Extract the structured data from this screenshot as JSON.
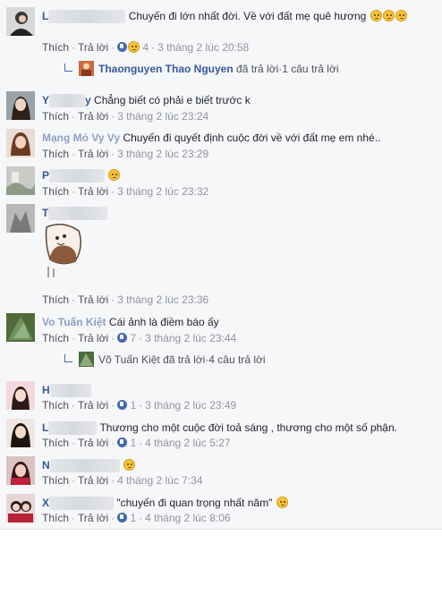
{
  "colors": {
    "link": "#365899",
    "meta": "#90949c",
    "like": "#4267b2",
    "bg": "#f6f7f9"
  },
  "labels": {
    "like": "Thích",
    "reply": "Trả lời",
    "dot": "·"
  },
  "comments": [
    {
      "name_frag": "L",
      "text": "Chuyến đi lớn nhất đời. Về với đất mẹ quê hương",
      "emojis": 3,
      "likes": "4",
      "time": "3 tháng 2 lúc 20:58",
      "reply_summary": {
        "name": "Thaonguyen Thao Nguyen",
        "action": "đã trả lời",
        "count": "1 câu trả lời"
      }
    },
    {
      "name_frag": "Y",
      "name_frag2": "y",
      "text": "Chẳng biết có phải e biết trước k",
      "time": "3 tháng 2 lúc 23:24"
    },
    {
      "name_frag": "Mạng Mỏ Vy Vy",
      "text": "Chuyến đi quyết định cuộc đời về với đất mẹ em nhé..",
      "time": "3 tháng 2 lúc 23:29"
    },
    {
      "name_frag": "P",
      "text": "",
      "emojis": 1,
      "time": "3 tháng 2 lúc 23:32"
    },
    {
      "name_frag": "T",
      "text": "",
      "time": "3 tháng 2 lúc 23:36",
      "sticker": "sticker-image"
    },
    {
      "name_frag": "Vo Tuấn Kiệt",
      "text": "Cái ảnh là điềm báo ấy",
      "likes": "7",
      "time": "3 tháng 2 lúc 23:44",
      "reply_summary": {
        "name": "Võ Tuấn Kiệt",
        "action": "đã trả lời",
        "count": "4 câu trả lời"
      }
    },
    {
      "name_frag": "H",
      "text": "",
      "likes": "1",
      "time": "3 tháng 2 lúc 23:49"
    },
    {
      "name_frag": "L",
      "text": "Thương cho một cuộc đời toả sáng , thương cho một số phận.",
      "likes": "1",
      "time": "4 tháng 2 lúc 5:27"
    },
    {
      "name_frag": "N",
      "text": "",
      "emojis": 1,
      "time": "4 tháng 2 lúc 7:34"
    },
    {
      "name_frag": "X",
      "text": "\"chuyến đi quan trọng nhất năm\"",
      "emojis": 1,
      "likes": "1",
      "time": "4 tháng 2 lúc 8:06"
    }
  ]
}
